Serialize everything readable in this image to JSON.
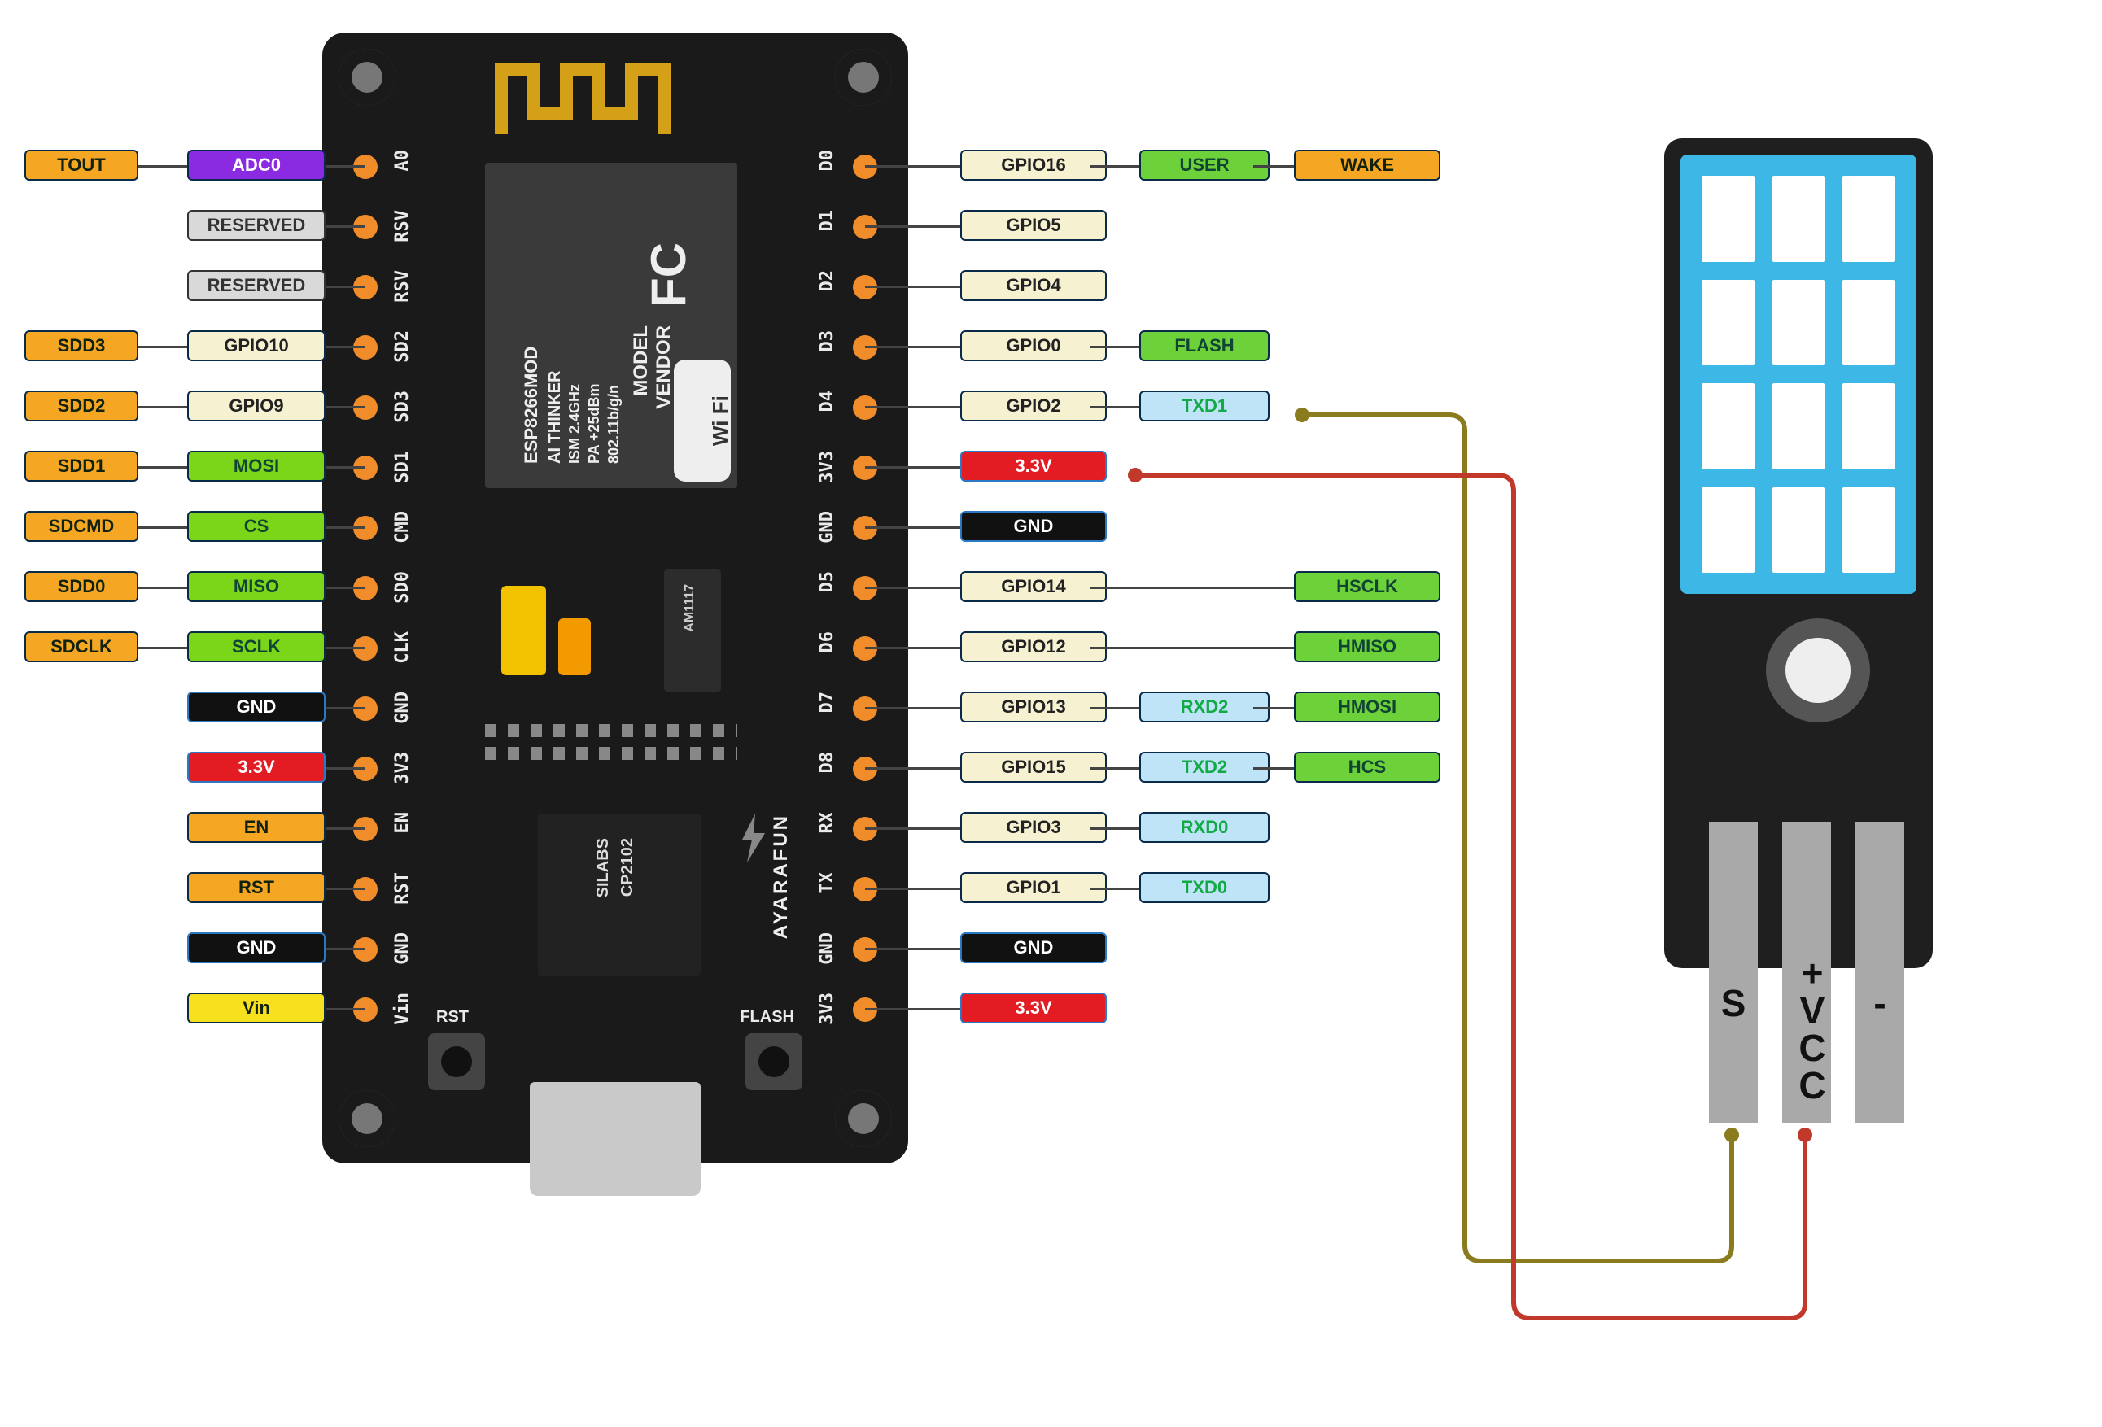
{
  "board": {
    "module_text": [
      "ESP8266MOD",
      "AI THINKER",
      "ISM 2.4GHz",
      "PA +25dBm",
      "802.11b/g/n",
      "MODEL",
      "VENDOR",
      "FC",
      "Wi Fi"
    ],
    "usb_chip": [
      "SILABS",
      "CP2102"
    ],
    "regulator": "AM1117",
    "bottom_buttons": {
      "left": "RST",
      "right": "FLASH"
    },
    "right_brand": "AYARAFUN",
    "silk_left": [
      "A0",
      "RSV",
      "RSV",
      "SD2",
      "SD3",
      "SD1",
      "CMD",
      "SD0",
      "CLK",
      "GND",
      "3V3",
      "EN",
      "RST",
      "GND",
      "Vin"
    ],
    "silk_right": [
      "D0",
      "D1",
      "D2",
      "D3",
      "D4",
      "3V3",
      "GND",
      "D5",
      "D6",
      "D7",
      "D8",
      "RX",
      "TX",
      "GND",
      "3V3"
    ]
  },
  "left_rows": [
    {
      "c1": {
        "t": "TOUT",
        "cls": "c-orange"
      },
      "c2": {
        "t": "ADC0",
        "cls": "c-purple"
      }
    },
    {
      "c2": {
        "t": "RESERVED",
        "cls": "c-grey"
      }
    },
    {
      "c2": {
        "t": "RESERVED",
        "cls": "c-grey"
      }
    },
    {
      "c1": {
        "t": "SDD3",
        "cls": "c-orange"
      },
      "c2": {
        "t": "GPIO10",
        "cls": "c-cream"
      }
    },
    {
      "c1": {
        "t": "SDD2",
        "cls": "c-orange"
      },
      "c2": {
        "t": "GPIO9",
        "cls": "c-cream"
      }
    },
    {
      "c1": {
        "t": "SDD1",
        "cls": "c-orange"
      },
      "c2": {
        "t": "MOSI",
        "cls": "c-lime"
      }
    },
    {
      "c1": {
        "t": "SDCMD",
        "cls": "c-orange"
      },
      "c2": {
        "t": "CS",
        "cls": "c-lime"
      }
    },
    {
      "c1": {
        "t": "SDD0",
        "cls": "c-orange"
      },
      "c2": {
        "t": "MISO",
        "cls": "c-lime"
      }
    },
    {
      "c1": {
        "t": "SDCLK",
        "cls": "c-orange"
      },
      "c2": {
        "t": "SCLK",
        "cls": "c-lime"
      }
    },
    {
      "c2": {
        "t": "GND",
        "cls": "c-black"
      }
    },
    {
      "c2": {
        "t": "3.3V",
        "cls": "c-red"
      }
    },
    {
      "c2": {
        "t": "EN",
        "cls": "c-orange"
      }
    },
    {
      "c2": {
        "t": "RST",
        "cls": "c-orange"
      }
    },
    {
      "c2": {
        "t": "GND",
        "cls": "c-black"
      }
    },
    {
      "c2": {
        "t": "Vin",
        "cls": "c-yellow"
      }
    }
  ],
  "right_rows": [
    {
      "c1": {
        "t": "GPIO16",
        "cls": "c-cream"
      },
      "c2": {
        "t": "USER",
        "cls": "c-lime2"
      },
      "c3": {
        "t": "WAKE",
        "cls": "c-orange"
      }
    },
    {
      "c1": {
        "t": "GPIO5",
        "cls": "c-cream"
      }
    },
    {
      "c1": {
        "t": "GPIO4",
        "cls": "c-cream"
      }
    },
    {
      "c1": {
        "t": "GPIO0",
        "cls": "c-cream"
      },
      "c2": {
        "t": "FLASH",
        "cls": "c-lime2"
      }
    },
    {
      "c1": {
        "t": "GPIO2",
        "cls": "c-cream"
      },
      "c2": {
        "t": "TXD1",
        "cls": "c-sky skytxt"
      }
    },
    {
      "c1": {
        "t": "3.3V",
        "cls": "c-red"
      }
    },
    {
      "c1": {
        "t": "GND",
        "cls": "c-black"
      }
    },
    {
      "c1": {
        "t": "GPIO14",
        "cls": "c-cream"
      },
      "c3": {
        "t": "HSCLK",
        "cls": "c-lime2"
      }
    },
    {
      "c1": {
        "t": "GPIO12",
        "cls": "c-cream"
      },
      "c3": {
        "t": "HMISO",
        "cls": "c-lime2"
      }
    },
    {
      "c1": {
        "t": "GPIO13",
        "cls": "c-cream"
      },
      "c2": {
        "t": "RXD2",
        "cls": "c-sky"
      },
      "c3": {
        "t": "HMOSI",
        "cls": "c-lime2"
      }
    },
    {
      "c1": {
        "t": "GPIO15",
        "cls": "c-cream"
      },
      "c2": {
        "t": "TXD2",
        "cls": "c-sky"
      },
      "c3": {
        "t": "HCS",
        "cls": "c-lime2"
      }
    },
    {
      "c1": {
        "t": "GPIO3",
        "cls": "c-cream"
      },
      "c2": {
        "t": "RXD0",
        "cls": "c-sky"
      }
    },
    {
      "c1": {
        "t": "GPIO1",
        "cls": "c-cream"
      },
      "c2": {
        "t": "TXD0",
        "cls": "c-sky"
      }
    },
    {
      "c1": {
        "t": "GND",
        "cls": "c-black"
      }
    },
    {
      "c1": {
        "t": "3.3V",
        "cls": "c-red"
      }
    }
  ],
  "sensor": {
    "legs": [
      "S",
      "+VCC",
      "-"
    ]
  },
  "wires": [
    {
      "name": "signal",
      "color": "#8a7b1f"
    },
    {
      "name": "vcc",
      "color": "#c0392b"
    }
  ]
}
